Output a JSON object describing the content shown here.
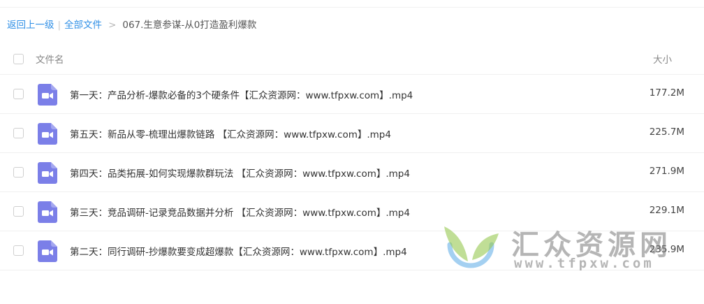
{
  "breadcrumb": {
    "back": "返回上一级",
    "separator": "|",
    "all_files": "全部文件",
    "arrow": ">",
    "current": "067.生意参谋-从0打造盈利爆款"
  },
  "table": {
    "header_name": "文件名",
    "header_size": "大小",
    "rows": [
      {
        "name": "第一天：产品分析-爆款必备的3个硬条件【汇众资源网：www.tfpxw.com】.mp4",
        "size": "177.2M",
        "icon": "video-file-icon"
      },
      {
        "name": "第五天：新品从零-梳理出爆款链路 【汇众资源网：www.tfpxw.com】.mp4",
        "size": "225.7M",
        "icon": "video-file-icon"
      },
      {
        "name": "第四天：品类拓展-如何实现爆款群玩法 【汇众资源网：www.tfpxw.com】.mp4",
        "size": "271.9M",
        "icon": "video-file-icon"
      },
      {
        "name": "第三天：竞品调研-记录竞品数据并分析 【汇众资源网：www.tfpxw.com】.mp4",
        "size": "229.1M",
        "icon": "video-file-icon"
      },
      {
        "name": "第二天：同行调研-抄爆款要变成超爆款【汇众资源网：www.tfpxw.com】.mp4",
        "size": "235.9M",
        "icon": "video-file-icon"
      }
    ]
  },
  "watermark": {
    "title": "汇众资源网",
    "url": "www.tfpxw.com"
  },
  "colors": {
    "link": "#2f8fe6",
    "video_icon": "#7b7fe8"
  }
}
